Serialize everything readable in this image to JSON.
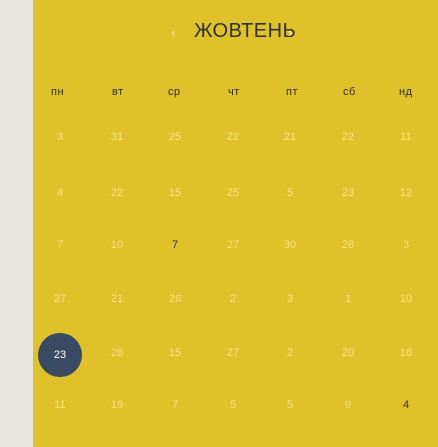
{
  "calendar": {
    "month": "ЖОВТЕНЬ",
    "prev_icon": "‹",
    "next_icon": "›",
    "weekdays": [
      "пн",
      "вт",
      "ср",
      "чт",
      "пт",
      "сб",
      "нд"
    ],
    "rows": [
      [
        "3",
        "31",
        "25",
        "22",
        "21",
        "22",
        "11"
      ],
      [
        "4",
        "22",
        "15",
        "25",
        "5",
        "23",
        "12"
      ],
      [
        "7",
        "10",
        "7",
        "27",
        "30",
        "28",
        "3"
      ],
      [
        "27",
        "21",
        "26",
        "2",
        "3",
        "1",
        "10"
      ],
      [
        "23",
        "28",
        "15",
        "27",
        "2",
        "20",
        "16"
      ],
      [
        "11",
        "19",
        "7",
        "5",
        "5",
        "9",
        "4"
      ]
    ],
    "selected_day": "23"
  }
}
